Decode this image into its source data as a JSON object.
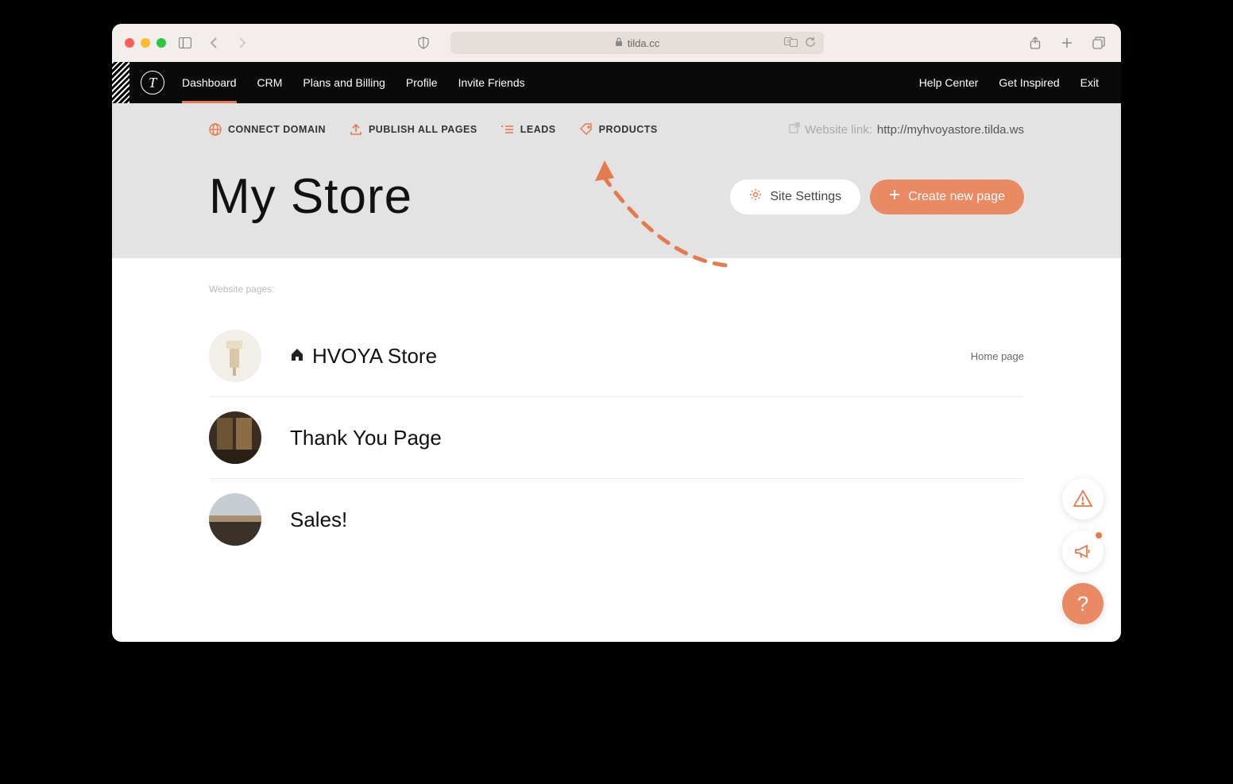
{
  "browser": {
    "url_host": "tilda.cc"
  },
  "topnav": {
    "items": [
      "Dashboard",
      "CRM",
      "Plans and Billing",
      "Profile",
      "Invite Friends"
    ],
    "right": [
      "Help Center",
      "Get Inspired",
      "Exit"
    ]
  },
  "actions": {
    "connect_domain": "CONNECT DOMAIN",
    "publish_all": "PUBLISH ALL PAGES",
    "leads": "LEADS",
    "products": "PRODUCTS"
  },
  "website_link": {
    "label": "Website link:",
    "url": "http://myhvoyastore.tilda.ws"
  },
  "site_title": "My Store",
  "buttons": {
    "site_settings": "Site Settings",
    "create_page": "Create new page"
  },
  "pages_section_label": "Website pages:",
  "pages": [
    {
      "title": "HVOYA Store",
      "is_home": true,
      "tag": "Home page"
    },
    {
      "title": "Thank You Page",
      "is_home": false,
      "tag": ""
    },
    {
      "title": "Sales!",
      "is_home": false,
      "tag": ""
    }
  ]
}
